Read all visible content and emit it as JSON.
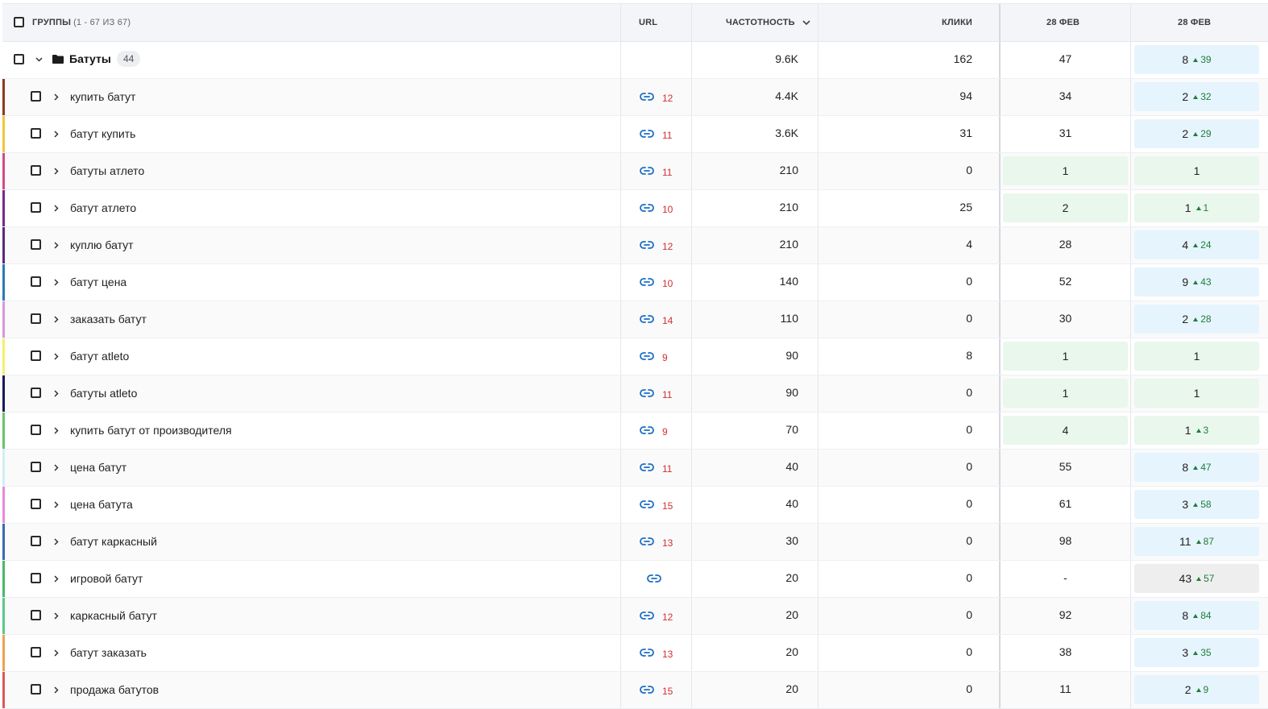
{
  "header": {
    "groups_label": "ГРУППЫ",
    "groups_range": "(1 - 67 ИЗ 67)",
    "url": "URL",
    "frequency": "ЧАСТОТНОСТЬ",
    "clicks": "КЛИКИ",
    "date1": "28 ФЕВ",
    "date2": "28 ФЕВ"
  },
  "group": {
    "name": "Батуты",
    "count": "44",
    "frequency": "9.6K",
    "clicks": "162",
    "pos1": "47",
    "pos2": "8",
    "pos2_delta": "39",
    "pos2_style": "blue"
  },
  "rows": [
    {
      "keyword": "купить батут",
      "stripe": "#8b3a1e",
      "urls": "12",
      "frequency": "4.4K",
      "clicks": "94",
      "pos1": "34",
      "pos1_style": "",
      "pos2": "2",
      "delta": "32",
      "pos2_style": "blue"
    },
    {
      "keyword": "батут купить",
      "stripe": "#f2c53d",
      "urls": "11",
      "frequency": "3.6K",
      "clicks": "31",
      "pos1": "31",
      "pos1_style": "",
      "pos2": "2",
      "delta": "29",
      "pos2_style": "blue"
    },
    {
      "keyword": "батуты атлето",
      "stripe": "#d44a8a",
      "urls": "11",
      "frequency": "210",
      "clicks": "0",
      "pos1": "1",
      "pos1_style": "green",
      "pos2": "1",
      "delta": "",
      "pos2_style": "green"
    },
    {
      "keyword": "батут атлето",
      "stripe": "#7a2a8a",
      "urls": "10",
      "frequency": "210",
      "clicks": "25",
      "pos1": "2",
      "pos1_style": "green",
      "pos2": "1",
      "delta": "1",
      "pos2_style": "green"
    },
    {
      "keyword": "куплю батут",
      "stripe": "#5a2a7a",
      "urls": "12",
      "frequency": "210",
      "clicks": "4",
      "pos1": "28",
      "pos1_style": "",
      "pos2": "4",
      "delta": "24",
      "pos2_style": "blue"
    },
    {
      "keyword": "батут цена",
      "stripe": "#2a7ab8",
      "urls": "10",
      "frequency": "140",
      "clicks": "0",
      "pos1": "52",
      "pos1_style": "",
      "pos2": "9",
      "delta": "43",
      "pos2_style": "blue"
    },
    {
      "keyword": "заказать батут",
      "stripe": "#d89ad8",
      "urls": "14",
      "frequency": "110",
      "clicks": "0",
      "pos1": "30",
      "pos1_style": "",
      "pos2": "2",
      "delta": "28",
      "pos2_style": "blue"
    },
    {
      "keyword": "батут atleto",
      "stripe": "#f5f06a",
      "urls": "9",
      "frequency": "90",
      "clicks": "8",
      "pos1": "1",
      "pos1_style": "green",
      "pos2": "1",
      "delta": "",
      "pos2_style": "green"
    },
    {
      "keyword": "батуты atleto",
      "stripe": "#1a1a5a",
      "urls": "11",
      "frequency": "90",
      "clicks": "0",
      "pos1": "1",
      "pos1_style": "green",
      "pos2": "1",
      "delta": "",
      "pos2_style": "green"
    },
    {
      "keyword": "купить батут от производителя",
      "stripe": "#6ac46a",
      "urls": "9",
      "frequency": "70",
      "clicks": "0",
      "pos1": "4",
      "pos1_style": "green",
      "pos2": "1",
      "delta": "3",
      "pos2_style": "green"
    },
    {
      "keyword": "цена батут",
      "stripe": "#cfeef5",
      "urls": "11",
      "frequency": "40",
      "clicks": "0",
      "pos1": "55",
      "pos1_style": "",
      "pos2": "8",
      "delta": "47",
      "pos2_style": "blue"
    },
    {
      "keyword": "цена батута",
      "stripe": "#e88ad8",
      "urls": "15",
      "frequency": "40",
      "clicks": "0",
      "pos1": "61",
      "pos1_style": "",
      "pos2": "3",
      "delta": "58",
      "pos2_style": "blue"
    },
    {
      "keyword": "батут каркасный",
      "stripe": "#3a6ab8",
      "urls": "13",
      "frequency": "30",
      "clicks": "0",
      "pos1": "98",
      "pos1_style": "",
      "pos2": "11",
      "delta": "87",
      "pos2_style": "blue"
    },
    {
      "keyword": "игровой батут",
      "stripe": "#4ab86a",
      "urls": "",
      "frequency": "20",
      "clicks": "0",
      "pos1": "-",
      "pos1_style": "",
      "pos2": "43",
      "delta": "57",
      "pos2_style": "gray"
    },
    {
      "keyword": "каркасный батут",
      "stripe": "#5ac88a",
      "urls": "12",
      "frequency": "20",
      "clicks": "0",
      "pos1": "92",
      "pos1_style": "",
      "pos2": "8",
      "delta": "84",
      "pos2_style": "blue"
    },
    {
      "keyword": "батут заказать",
      "stripe": "#f0a050",
      "urls": "13",
      "frequency": "20",
      "clicks": "0",
      "pos1": "38",
      "pos1_style": "",
      "pos2": "3",
      "delta": "35",
      "pos2_style": "blue"
    },
    {
      "keyword": "продажа батутов",
      "stripe": "#d85a5a",
      "urls": "15",
      "frequency": "20",
      "clicks": "0",
      "pos1": "11",
      "pos1_style": "",
      "pos2": "2",
      "delta": "9",
      "pos2_style": "blue"
    }
  ]
}
